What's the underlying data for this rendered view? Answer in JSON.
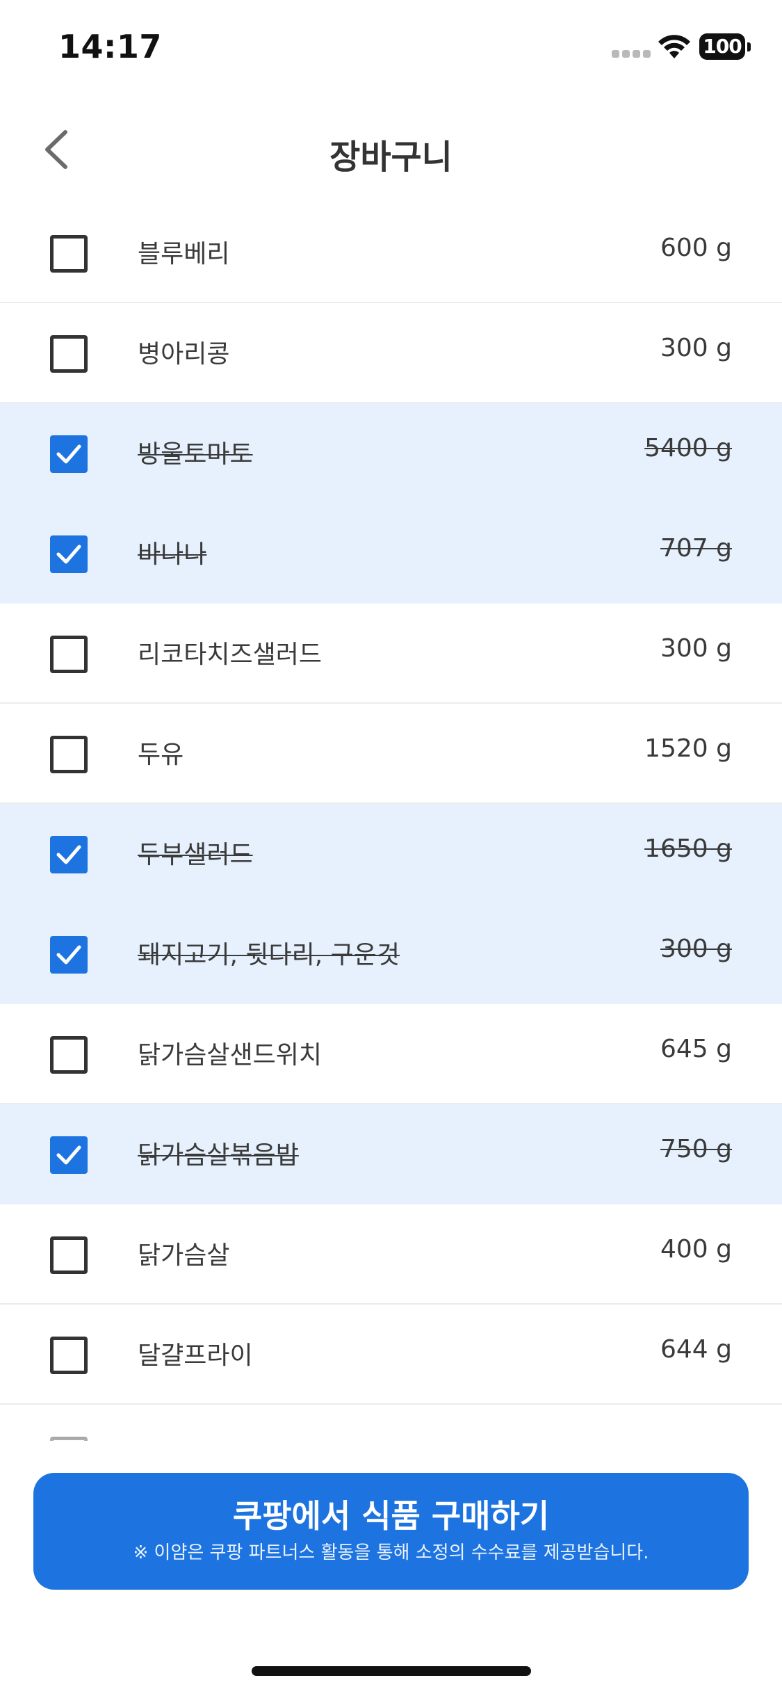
{
  "status_bar": {
    "time": "14:17",
    "battery": "100",
    "icons": [
      "signal-icon",
      "wifi-icon",
      "battery-icon"
    ]
  },
  "header": {
    "title": "장바구니",
    "back_icon": "chevron-left-icon"
  },
  "items": [
    {
      "name": "블루베리",
      "quantity": "600 g",
      "checked": false
    },
    {
      "name": "병아리콩",
      "quantity": "300 g",
      "checked": false
    },
    {
      "name": "방울토마토",
      "quantity": "5400 g",
      "checked": true
    },
    {
      "name": "바나나",
      "quantity": "707 g",
      "checked": true
    },
    {
      "name": "리코타치즈샐러드",
      "quantity": "300 g",
      "checked": false
    },
    {
      "name": "두유",
      "quantity": "1520 g",
      "checked": false
    },
    {
      "name": "두부샐러드",
      "quantity": "1650 g",
      "checked": true
    },
    {
      "name": "돼지고기, 뒷다리, 구운것",
      "quantity": "300 g",
      "checked": true
    },
    {
      "name": "닭가슴살샌드위치",
      "quantity": "645 g",
      "checked": false
    },
    {
      "name": "닭가슴살볶음밥",
      "quantity": "750 g",
      "checked": true
    },
    {
      "name": "닭가슴살",
      "quantity": "400 g",
      "checked": false
    },
    {
      "name": "달걀프라이",
      "quantity": "644 g",
      "checked": false
    },
    {
      "name": "",
      "quantity": "",
      "checked": false
    }
  ],
  "cta": {
    "title": "쿠팡에서 식품 구매하기",
    "subtitle": "※ 이얌은 쿠팡 파트너스 활동을 통해 소정의 수수료를 제공받습니다."
  },
  "colors": {
    "accent": "#1d74e0",
    "checked_row": "#e6f1fd",
    "text": "#333333"
  }
}
